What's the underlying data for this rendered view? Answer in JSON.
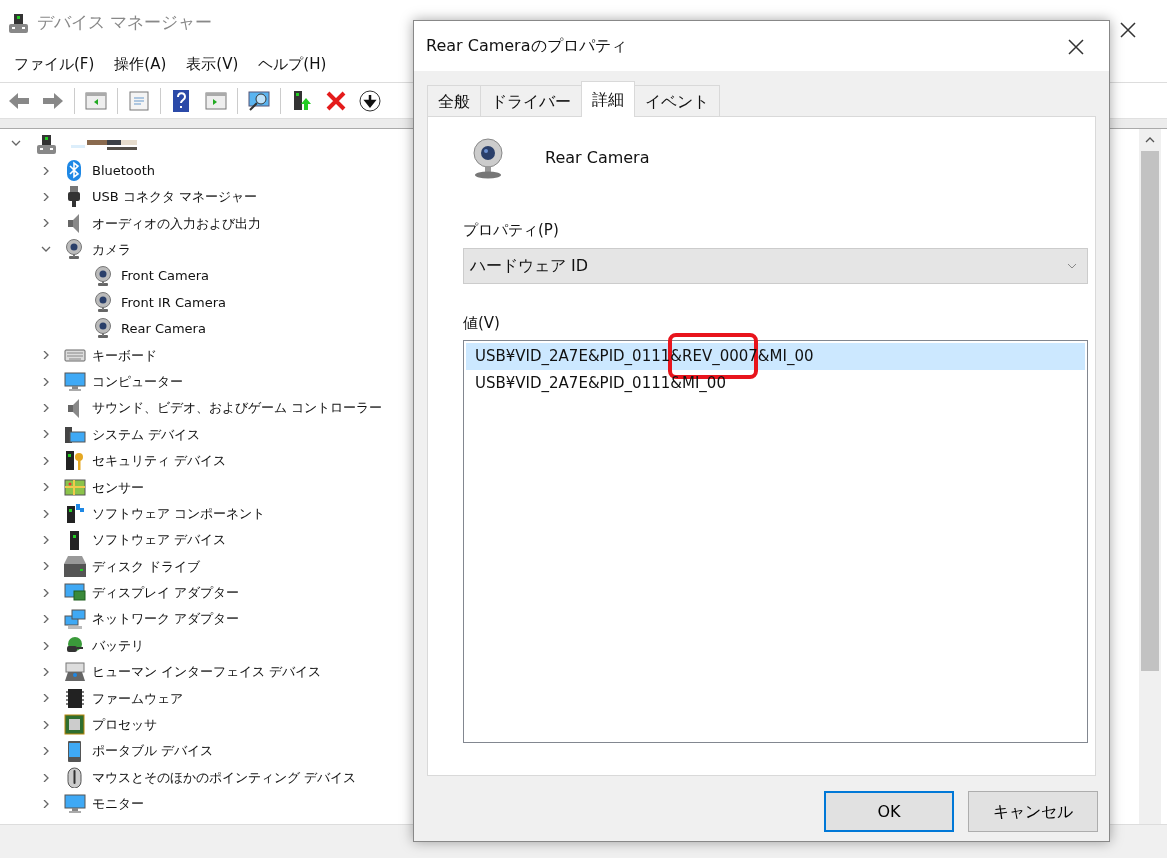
{
  "main_window": {
    "title": "デバイス マネージャー",
    "menu": [
      "ファイル(F)",
      "操作(A)",
      "表示(V)",
      "ヘルプ(H)"
    ],
    "tree": {
      "expanded": true,
      "children": [
        {
          "label": "Bluetooth",
          "kind": "bluetooth",
          "expanded": false
        },
        {
          "label": "USB コネクタ マネージャー",
          "kind": "usb",
          "expanded": false
        },
        {
          "label": "オーディオの入力および出力",
          "kind": "speaker",
          "expanded": false
        },
        {
          "label": "カメラ",
          "kind": "webcam",
          "expanded": true,
          "children": [
            {
              "label": "Front Camera",
              "kind": "webcam"
            },
            {
              "label": "Front IR Camera",
              "kind": "webcam"
            },
            {
              "label": "Rear Camera",
              "kind": "webcam"
            }
          ]
        },
        {
          "label": "キーボード",
          "kind": "keyboard",
          "expanded": false
        },
        {
          "label": "コンピューター",
          "kind": "monitor",
          "expanded": false
        },
        {
          "label": "サウンド、ビデオ、およびゲーム コントローラー",
          "kind": "speaker",
          "expanded": false
        },
        {
          "label": "システム デバイス",
          "kind": "system",
          "expanded": false
        },
        {
          "label": "セキュリティ デバイス",
          "kind": "security",
          "expanded": false
        },
        {
          "label": "センサー",
          "kind": "sensor",
          "expanded": false
        },
        {
          "label": "ソフトウェア コンポーネント",
          "kind": "component",
          "expanded": false
        },
        {
          "label": "ソフトウェア デバイス",
          "kind": "tower",
          "expanded": false
        },
        {
          "label": "ディスク ドライブ",
          "kind": "disk",
          "expanded": false
        },
        {
          "label": "ディスプレイ アダプター",
          "kind": "display",
          "expanded": false
        },
        {
          "label": "ネットワーク アダプター",
          "kind": "network",
          "expanded": false
        },
        {
          "label": "バッテリ",
          "kind": "battery",
          "expanded": false
        },
        {
          "label": "ヒューマン インターフェイス デバイス",
          "kind": "hid",
          "expanded": false
        },
        {
          "label": "ファームウェア",
          "kind": "firmware",
          "expanded": false
        },
        {
          "label": "プロセッサ",
          "kind": "processor",
          "expanded": false
        },
        {
          "label": "ポータブル デバイス",
          "kind": "portable",
          "expanded": false
        },
        {
          "label": "マウスとそのほかのポインティング デバイス",
          "kind": "mouse",
          "expanded": false
        },
        {
          "label": "モニター",
          "kind": "monitor",
          "expanded": false
        }
      ]
    }
  },
  "dialog": {
    "title": "Rear Cameraのプロパティ",
    "tabs": [
      {
        "label": "全般",
        "selected": false
      },
      {
        "label": "ドライバー",
        "selected": false
      },
      {
        "label": "詳細",
        "selected": true
      },
      {
        "label": "イベント",
        "selected": false
      }
    ],
    "device_name": "Rear Camera",
    "property_label": "プロパティ(P)",
    "property_value": "ハードウェア ID",
    "values_label": "値(V)",
    "values": [
      {
        "text": "USB¥VID_2A7E&PID_0111&REV_0007&MI_00",
        "selected": true,
        "annotated": true
      },
      {
        "text": "USB¥VID_2A7E&PID_0111&MI_00",
        "selected": false,
        "annotated": false
      }
    ],
    "buttons": [
      {
        "label": "OK",
        "default": true
      },
      {
        "label": "キャンセル",
        "default": false
      }
    ]
  }
}
